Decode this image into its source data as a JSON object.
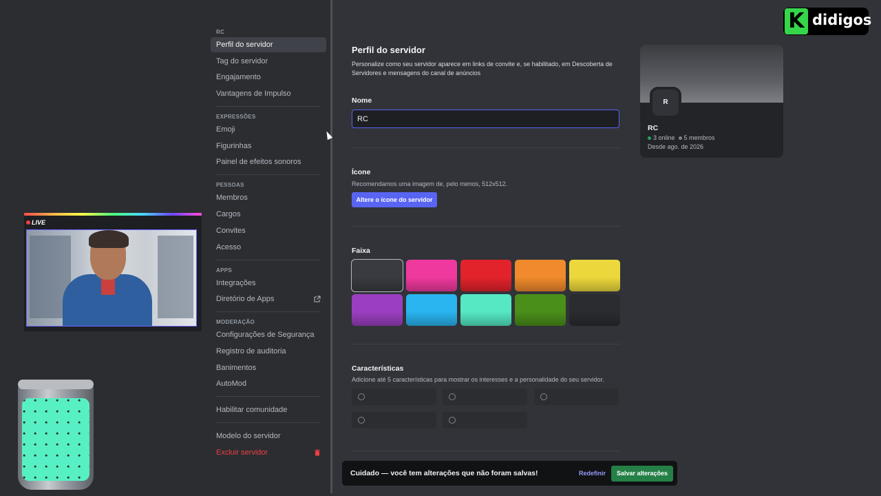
{
  "sidebar": {
    "sections": [
      {
        "header": "RC",
        "items": [
          "Perfil do servidor",
          "Tag do servidor",
          "Engajamento",
          "Vantagens de Impulso"
        ]
      },
      {
        "header": "Expressões",
        "items": [
          "Emoji",
          "Figurinhas",
          "Painel de efeitos sonoros"
        ]
      },
      {
        "header": "Pessoas",
        "items": [
          "Membros",
          "Cargos",
          "Convites",
          "Acesso"
        ]
      },
      {
        "header": "Apps",
        "items": [
          "Integrações",
          "Diretório de Apps"
        ]
      },
      {
        "header": "Moderação",
        "items": [
          "Configurações de Segurança",
          "Registro de auditoria",
          "Banimentos",
          "AutoMod"
        ]
      }
    ],
    "community": "Habilitar comunidade",
    "template": "Modelo do servidor",
    "delete": "Excluir servidor"
  },
  "webcam": {
    "live_label": "LIVE"
  },
  "logo": {
    "text": "didigos",
    "mark": "K"
  },
  "main": {
    "title": "Perfil do servidor",
    "description": "Personalize como seu servidor aparece em links de convite e, se habilitado, em Descoberta de Servidores e mensagens do canal de anúncios",
    "name_label": "Nome",
    "name_value": "RC",
    "icon_label": "Ícone",
    "icon_hint": "Recomendamos uma imagem de, pelo menos, 512x512.",
    "icon_button": "Altere o ícone do servidor",
    "banner_label": "Faixa",
    "banner_colors": [
      "#3a3b40",
      "#f0399e",
      "#e3232b",
      "#f08a2c",
      "#ecd83c",
      "#9b3fc0",
      "#2ab4f0",
      "#55e8c3",
      "#4a8f1a",
      "#2b2c30"
    ],
    "traits_label": "Características",
    "traits_hint": "Adicione até 5 características para mostrar os interesses e a personalidade do seu servidor."
  },
  "preview": {
    "avatar_letter": "R",
    "name": "RC",
    "online": "3 online",
    "members": "5 membros",
    "since": "Desde ago. de 2026"
  },
  "notice": {
    "message": "Cuidado — você tem alterações que não foram salvas!",
    "reset": "Redefinir",
    "save": "Salvar alterações"
  }
}
